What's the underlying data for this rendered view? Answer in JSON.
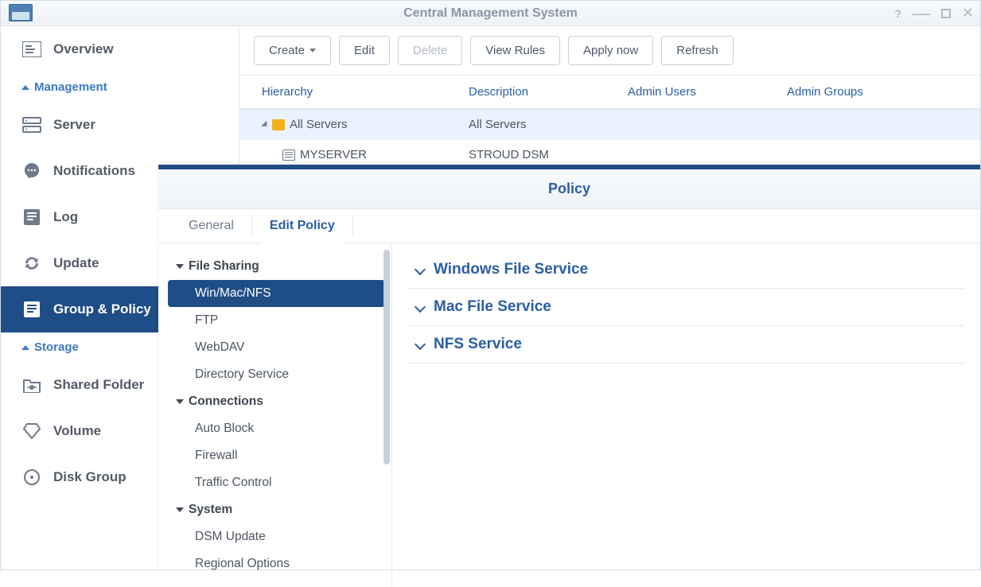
{
  "window": {
    "title": "Central Management System"
  },
  "sidebar": {
    "sections": {
      "management_label": "Management",
      "storage_label": "Storage"
    },
    "items": {
      "overview": "Overview",
      "server": "Server",
      "notifications": "Notifications",
      "log": "Log",
      "update": "Update",
      "group_policy": "Group & Policy",
      "shared_folder": "Shared Folder",
      "volume": "Volume",
      "disk_group": "Disk Group"
    }
  },
  "toolbar": {
    "create": "Create",
    "edit": "Edit",
    "delete": "Delete",
    "view_rules": "View Rules",
    "apply_now": "Apply now",
    "refresh": "Refresh"
  },
  "grid": {
    "headers": {
      "hierarchy": "Hierarchy",
      "description": "Description",
      "admin_users": "Admin Users",
      "admin_groups": "Admin Groups"
    },
    "rows": [
      {
        "hierarchy": "All Servers",
        "description": "All Servers"
      },
      {
        "hierarchy": "MYSERVER",
        "description": "STROUD DSM"
      }
    ]
  },
  "panel": {
    "title": "Policy",
    "tabs": {
      "general": "General",
      "edit_policy": "Edit Policy"
    },
    "groups": [
      {
        "label": "File Sharing",
        "items": [
          "Win/Mac/NFS",
          "FTP",
          "WebDAV",
          "Directory Service"
        ]
      },
      {
        "label": "Connections",
        "items": [
          "Auto Block",
          "Firewall",
          "Traffic Control"
        ]
      },
      {
        "label": "System",
        "items": [
          "DSM Update",
          "Regional Options"
        ]
      }
    ],
    "accordion": [
      "Windows File Service",
      "Mac File Service",
      "NFS Service"
    ]
  }
}
